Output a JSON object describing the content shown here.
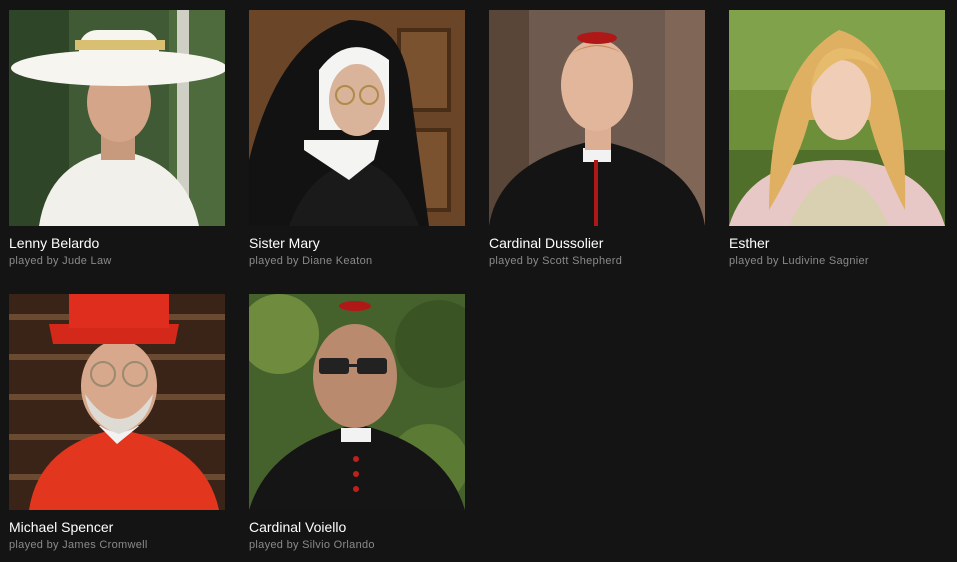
{
  "cast": [
    {
      "character": "Lenny Belardo",
      "actor_line": "played by Jude Law",
      "photo_icon": "portrait-photo"
    },
    {
      "character": "Sister Mary",
      "actor_line": "played by Diane Keaton",
      "photo_icon": "portrait-photo"
    },
    {
      "character": "Cardinal Dussolier",
      "actor_line": "played by Scott Shepherd",
      "photo_icon": "portrait-photo"
    },
    {
      "character": "Esther",
      "actor_line": "played by Ludivine Sagnier",
      "photo_icon": "portrait-photo"
    },
    {
      "character": "Michael Spencer",
      "actor_line": "played by James Cromwell",
      "photo_icon": "portrait-photo"
    },
    {
      "character": "Cardinal Voiello",
      "actor_line": "played by Silvio Orlando",
      "photo_icon": "portrait-photo"
    }
  ],
  "colors": {
    "background": "#141414",
    "name_text": "#ffffff",
    "actor_text": "#8a8a8a"
  }
}
